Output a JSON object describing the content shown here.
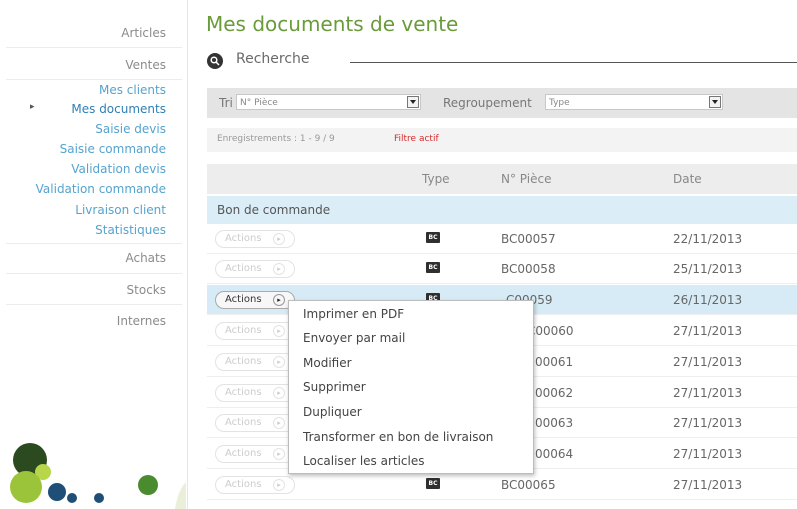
{
  "page_title": "Mes documents de vente",
  "search": {
    "label": "Recherche"
  },
  "sidebar": {
    "articles": "Articles",
    "ventes": "Ventes",
    "sub_items": [
      "Mes clients",
      "Mes documents",
      "Saisie devis",
      "Saisie commande",
      "Validation devis",
      "Validation commande",
      "Livraison client",
      "Statistiques"
    ],
    "achats": "Achats",
    "stocks": "Stocks",
    "internes": "Internes"
  },
  "filters": {
    "tri_label": "Tri",
    "tri_value": "N° Pièce",
    "regroupement_label": "Regroupement",
    "regroupement_value": "Type"
  },
  "records": {
    "count_text": "Enregistrements : 1 - 9 / 9",
    "filter_text": "Filtre actif"
  },
  "table": {
    "headers": {
      "type": "Type",
      "piece": "N° Pièce",
      "date": "Date"
    },
    "group": "Bon de commande",
    "actions_label": "Actions",
    "type_badge": "BC",
    "rows": [
      {
        "piece": "BC00057",
        "date": "22/11/2013"
      },
      {
        "piece": "BC00058",
        "date": "25/11/2013"
      },
      {
        "piece": "BC00059",
        "date": "26/11/2013"
      },
      {
        "piece": "BC00060",
        "date": "27/11/2013"
      },
      {
        "piece": "BC00061",
        "date": "27/11/2013"
      },
      {
        "piece": "BC00062",
        "date": "27/11/2013"
      },
      {
        "piece": "BC00063",
        "date": "27/11/2013"
      },
      {
        "piece": "BC00064",
        "date": "27/11/2013"
      },
      {
        "piece": "BC00065",
        "date": "27/11/2013"
      }
    ],
    "visible_piece_fragments": [
      "C00060",
      "00061",
      "00062",
      "00063",
      "00064"
    ],
    "visible_piece_fragment_row3": "C00059"
  },
  "context_menu": {
    "items": [
      "Imprimer en PDF",
      "Envoyer par mail",
      "Modifier",
      "Supprimer",
      "Dupliquer",
      "Transformer en bon de livraison",
      "Localiser les articles"
    ]
  }
}
